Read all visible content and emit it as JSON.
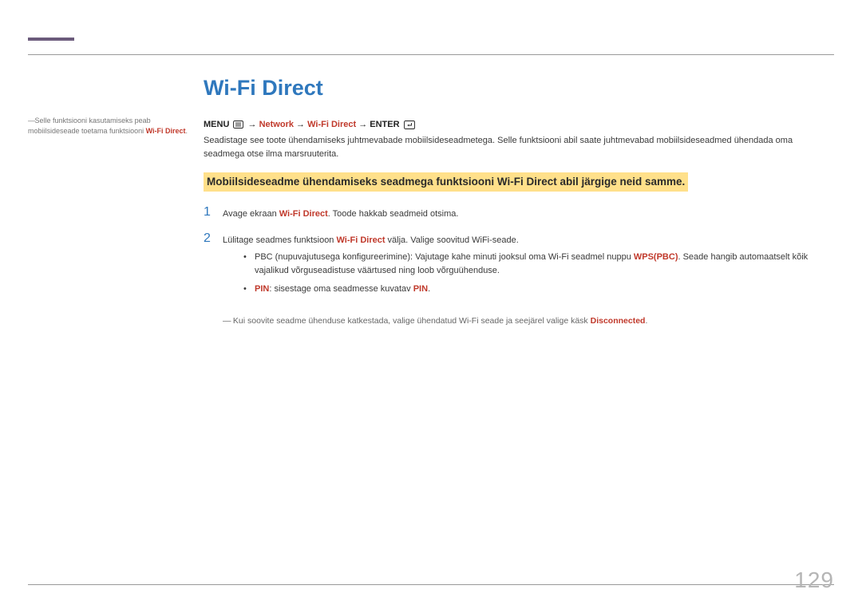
{
  "page_number": "129",
  "title": "Wi-Fi Direct",
  "sidebar": {
    "note_pre": "Selle funktsiooni kasutamiseks peab mobiilsideseade toetama funktsiooni ",
    "note_hl": "Wi-Fi Direct",
    "note_post": "."
  },
  "menu_path": {
    "menu_label": "MENU",
    "sep": " → ",
    "network": "Network",
    "wifi_direct": "Wi-Fi Direct",
    "enter_label": "ENTER"
  },
  "description": "Seadistage see toote ühendamiseks juhtmevabade mobiilsideseadmetega. Selle funktsiooni abil saate juhtmevabad mobiilsideseadmed ühendada oma seadmega otse ilma marsruuterita.",
  "callout": "Mobiilsideseadme ühendamiseks seadmega funktsiooni Wi-Fi Direct abil järgige neid samme.",
  "steps": {
    "s1": {
      "num": "1",
      "pre": "Avage ekraan ",
      "hl": "Wi-Fi Direct",
      "post": ". Toode hakkab seadmeid otsima."
    },
    "s2": {
      "num": "2",
      "pre": "Lülitage seadmes funktsioon ",
      "hl": "Wi-Fi Direct",
      "post": " välja. Valige soovitud WiFi-seade."
    }
  },
  "bullets": {
    "b1": {
      "pre": "PBC (nupuvajutusega konfigureerimine): Vajutage kahe minuti jooksul oma Wi-Fi seadmel nuppu ",
      "hl": "WPS(PBC)",
      "post": ". Seade hangib automaatselt kõik vajalikud võrguseadistuse väärtused ning loob võrguühenduse."
    },
    "b2": {
      "pre_hl": "PIN",
      "mid": ": sisestage oma seadmesse kuvatav ",
      "end_hl": "PIN",
      "post": "."
    }
  },
  "note": {
    "pre": "Kui soovite seadme ühenduse katkestada, valige ühendatud Wi-Fi seade ja seejärel valige käsk ",
    "hl": "Disconnected",
    "post": "."
  }
}
